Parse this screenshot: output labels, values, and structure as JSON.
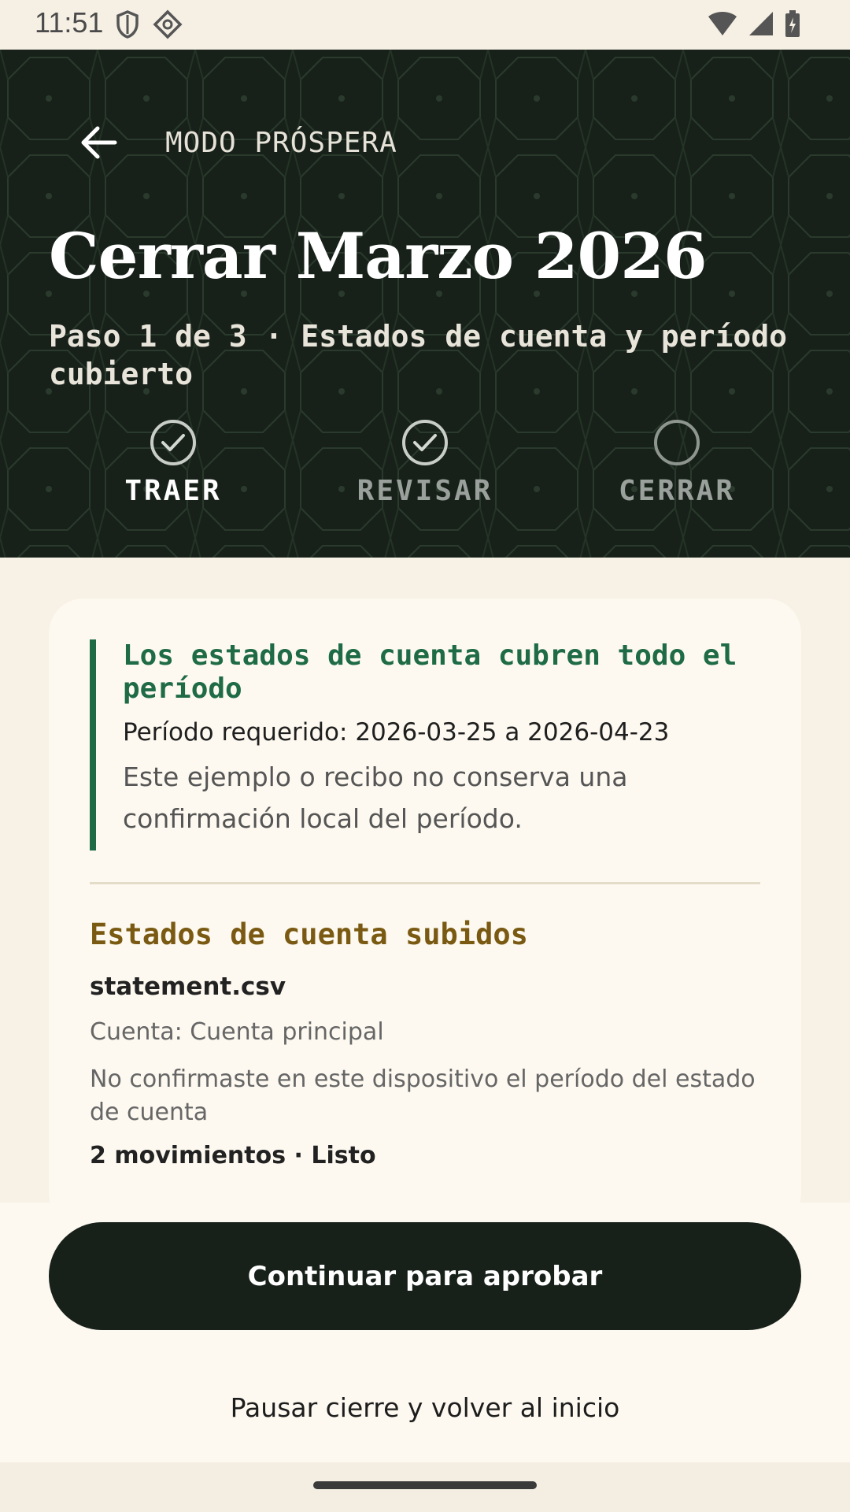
{
  "status_bar": {
    "time": "11:51"
  },
  "header": {
    "app_title": "MODO PRÓSPERA",
    "page_title": "Cerrar Marzo 2026",
    "step_subtitle": "Paso 1 de 3 · Estados de cuenta y período cubierto",
    "steps": [
      {
        "label": "TRAER",
        "state": "done",
        "active": true
      },
      {
        "label": "REVISAR",
        "state": "done",
        "active": false
      },
      {
        "label": "CERRAR",
        "state": "pending",
        "active": false
      }
    ]
  },
  "card": {
    "callout": {
      "title": "Los estados de cuenta cubren todo el período",
      "period": "Período requerido: 2026-03-25 a 2026-04-23",
      "note": "Este ejemplo o recibo no conserva una confirmación local del período."
    },
    "section_title": "Estados de cuenta subidos",
    "file": {
      "name": "statement.csv",
      "account": "Cuenta: Cuenta principal",
      "note": "No confirmaste en este dispositivo el período del estado de cuenta",
      "summary": "2 movimientos · Listo"
    }
  },
  "actions": {
    "primary_label": "Continuar para aprobar",
    "secondary_label": "Pausar cierre y volver al inicio"
  },
  "colors": {
    "header_bg": "#17211a",
    "accent_green": "#1e6b46",
    "accent_gold": "#7a5a12",
    "page_bg": "#f7f1e6"
  }
}
